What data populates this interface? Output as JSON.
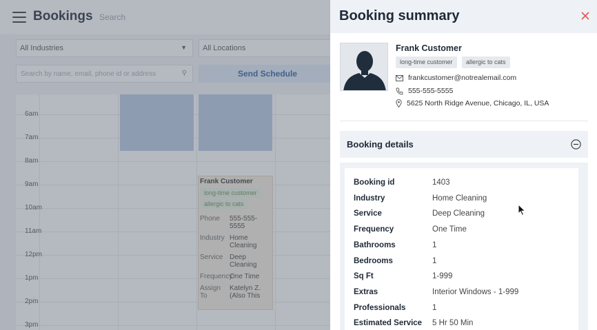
{
  "app": {
    "title": "Bookings",
    "search_placeholder": "Search",
    "filters": {
      "industries": "All Industries",
      "locations": "All Locations",
      "search_placeholder": "Search by name, email, phone id or address",
      "send_schedule": "Send Schedule"
    },
    "calendar": {
      "hours": [
        "6am",
        "7am",
        "8am",
        "9am",
        "10am",
        "11am",
        "12pm",
        "1pm",
        "2pm",
        "3pm"
      ],
      "event": {
        "name": "Frank Customer",
        "tags": [
          "long-time customer",
          "allergic to cats"
        ],
        "fields": [
          {
            "k": "Phone",
            "v": "555-555-5555"
          },
          {
            "k": "Industry",
            "v": "Home Cleaning"
          },
          {
            "k": "Service",
            "v": "Deep Cleaning"
          },
          {
            "k": "Frequency",
            "v": "One Time"
          },
          {
            "k": "Assign To",
            "v": "Katelyn Z. (Also This"
          }
        ]
      }
    }
  },
  "drawer": {
    "title": "Booking summary",
    "customer": {
      "name": "Frank Customer",
      "tags": [
        "long-time customer",
        "allergic to cats"
      ],
      "email": "frankcustomer@notrealemail.com",
      "phone": "555-555-5555",
      "address": "5625 North Ridge Avenue, Chicago, IL, USA"
    },
    "details": {
      "title": "Booking details",
      "rows": [
        {
          "label": "Booking id",
          "value": "1403"
        },
        {
          "label": "Industry",
          "value": "Home Cleaning"
        },
        {
          "label": "Service",
          "value": "Deep Cleaning"
        },
        {
          "label": "Frequency",
          "value": "One Time"
        },
        {
          "label": "Bathrooms",
          "value": "1"
        },
        {
          "label": "Bedrooms",
          "value": "1"
        },
        {
          "label": "Sq Ft",
          "value": "1-999"
        },
        {
          "label": "Extras",
          "value": "Interior Windows - 1-999"
        },
        {
          "label": "Professionals",
          "value": "1"
        },
        {
          "label": "Estimated Service",
          "value": "5 Hr 50 Min"
        }
      ]
    }
  },
  "colors": {
    "close": "#e0584f",
    "tag_bg": "#e6e9ed",
    "blocked": "#b9cbe6"
  }
}
